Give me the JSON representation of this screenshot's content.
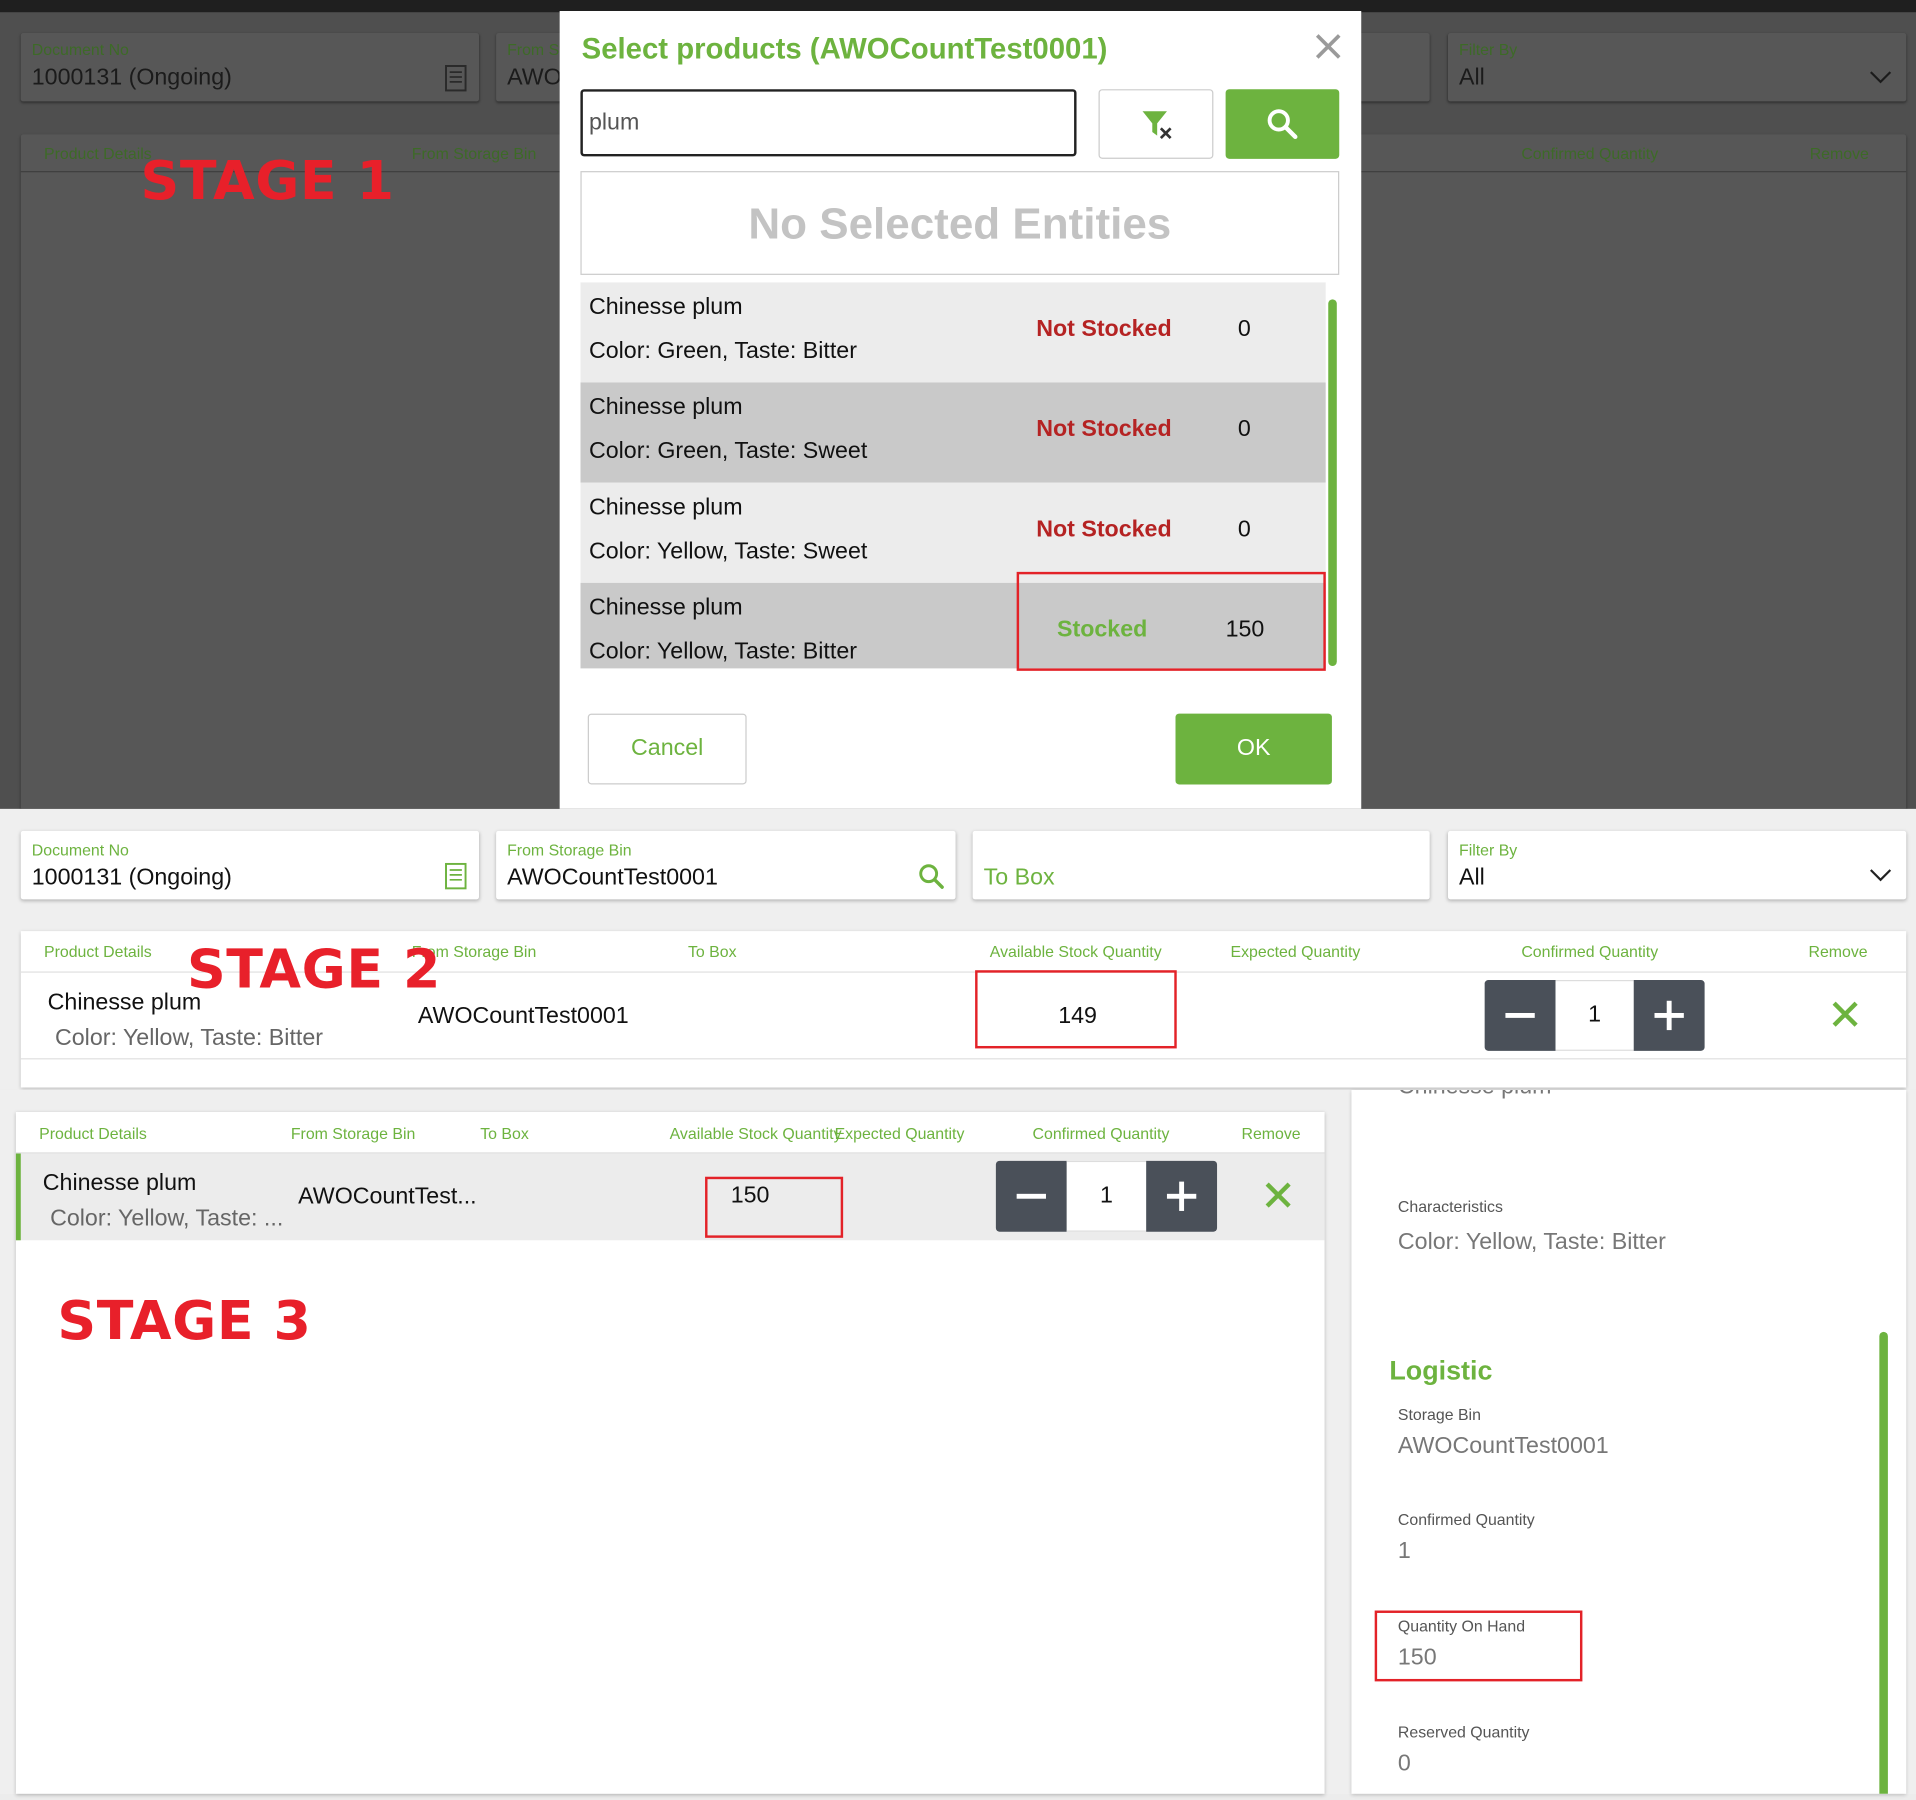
{
  "stages": {
    "s1": "STAGE 1",
    "s2": "STAGE 2",
    "s3": "STAGE 3"
  },
  "form": {
    "document_no_label": "Document No",
    "document_no_value": "1000131 (Ongoing)",
    "from_bin_label": "From Storage Bin",
    "from_bin_label_cut": "From St",
    "from_bin_value": "AWOCountTest0001",
    "from_bin_value_cut": "AWO",
    "to_box_placeholder": "To Box",
    "filter_label": "Filter By",
    "filter_value": "All"
  },
  "modal": {
    "title": "Select products (AWOCountTest0001)",
    "search_value": "plum",
    "no_selection": "No Selected Entities",
    "cancel": "Cancel",
    "ok": "OK",
    "rows": [
      {
        "name": "Chinesse plum",
        "attrs": "Color: Green, Taste: Bitter",
        "status": "Not Stocked",
        "qty": "0"
      },
      {
        "name": "Chinesse plum",
        "attrs": "Color: Green, Taste: Sweet",
        "status": "Not Stocked",
        "qty": "0"
      },
      {
        "name": "Chinesse plum",
        "attrs": "Color: Yellow, Taste: Sweet",
        "status": "Not Stocked",
        "qty": "0"
      },
      {
        "name": "Chinesse plum",
        "attrs": "Color: Yellow, Taste: Bitter",
        "status": "Stocked",
        "qty": "150"
      }
    ]
  },
  "table_headers": {
    "product_details": "Product Details",
    "from_storage_bin": "From Storage Bin",
    "to_box": "To Box",
    "available_stock": "Available Stock Quantity",
    "expected": "Expected Quantity",
    "confirmed": "Confirmed Quantity",
    "remove": "Remove"
  },
  "stage2_row": {
    "name": "Chinesse plum",
    "attrs": "Color: Yellow, Taste: Bitter",
    "bin": "AWOCountTest0001",
    "available": "149",
    "confirmed": "1"
  },
  "stage3_row": {
    "name": "Chinesse plum",
    "attrs": "Color: Yellow, Taste: ...",
    "bin": "AWOCountTest...",
    "available": "150",
    "confirmed": "1"
  },
  "side_panel": {
    "product_cut": "Chinesse plum",
    "characteristics_label": "Characteristics",
    "characteristics_value": "Color: Yellow, Taste: Bitter",
    "logistic_title": "Logistic",
    "storage_bin_label": "Storage Bin",
    "storage_bin_value": "AWOCountTest0001",
    "confirmed_label": "Confirmed Quantity",
    "confirmed_value": "1",
    "on_hand_label": "Quantity On Hand",
    "on_hand_value": "150",
    "reserved_label": "Reserved Quantity",
    "reserved_value": "0"
  },
  "colors": {
    "accent": "#6db33f",
    "not_stocked": "#b52323",
    "highlight": "#e32228",
    "stage_label": "#e8202a",
    "stepper": "#4a5059"
  }
}
